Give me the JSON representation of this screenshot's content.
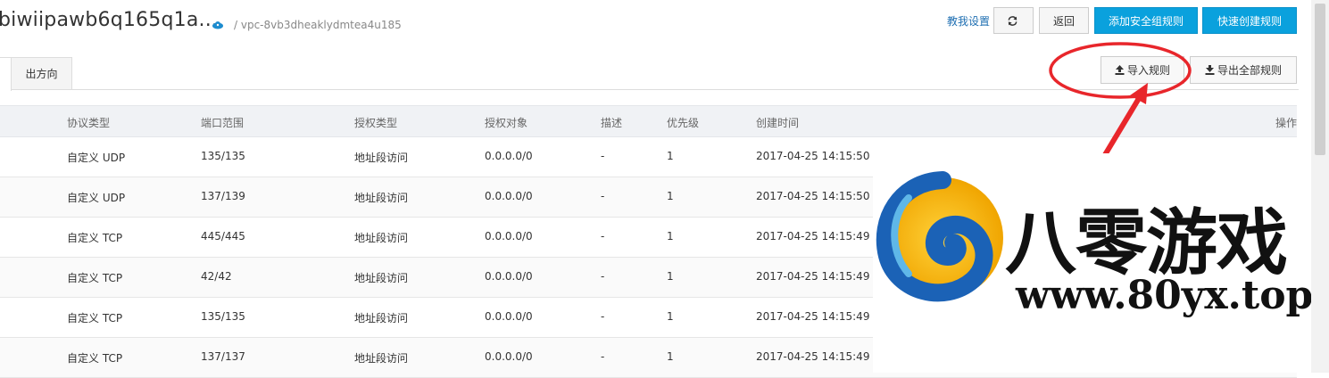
{
  "header": {
    "group_name": "biwiipawb6q165q1a...",
    "vpc_id": "/ vpc-8vb3dheaklydmtea4u185",
    "help_link": "教我设置",
    "back_label": "返回",
    "add_rule_label": "添加安全组规则",
    "quick_create_label": "快速创建规则"
  },
  "tabs": {
    "outbound_label": "出方向"
  },
  "toolbar": {
    "import_label": "导入规则",
    "export_label": "导出全部规则"
  },
  "table": {
    "headers": [
      "协议类型",
      "端口范围",
      "授权类型",
      "授权对象",
      "描述",
      "优先级",
      "创建时间",
      "操作"
    ],
    "rows": [
      {
        "protocol": "自定义 UDP",
        "port": "135/135",
        "auth_type": "地址段访问",
        "auth_object": "0.0.0.0/0",
        "desc": "-",
        "priority": "1",
        "created": "2017-04-25 14:15:50"
      },
      {
        "protocol": "自定义 UDP",
        "port": "137/139",
        "auth_type": "地址段访问",
        "auth_object": "0.0.0.0/0",
        "desc": "-",
        "priority": "1",
        "created": "2017-04-25 14:15:50"
      },
      {
        "protocol": "自定义 TCP",
        "port": "445/445",
        "auth_type": "地址段访问",
        "auth_object": "0.0.0.0/0",
        "desc": "-",
        "priority": "1",
        "created": "2017-04-25 14:15:49"
      },
      {
        "protocol": "自定义 TCP",
        "port": "42/42",
        "auth_type": "地址段访问",
        "auth_object": "0.0.0.0/0",
        "desc": "-",
        "priority": "1",
        "created": "2017-04-25 14:15:49"
      },
      {
        "protocol": "自定义 TCP",
        "port": "135/135",
        "auth_type": "地址段访问",
        "auth_object": "0.0.0.0/0",
        "desc": "-",
        "priority": "1",
        "created": "2017-04-25 14:15:49"
      },
      {
        "protocol": "自定义 TCP",
        "port": "137/137",
        "auth_type": "地址段访问",
        "auth_object": "0.0.0.0/0",
        "desc": "-",
        "priority": "1",
        "created": "2017-04-25 14:15:49"
      }
    ]
  },
  "watermark": {
    "name": "八零游戏",
    "url": "www.80yx.top"
  },
  "colors": {
    "primary": "#0aa1dd",
    "annotation": "#e8262b",
    "link": "#1f6fb2"
  }
}
